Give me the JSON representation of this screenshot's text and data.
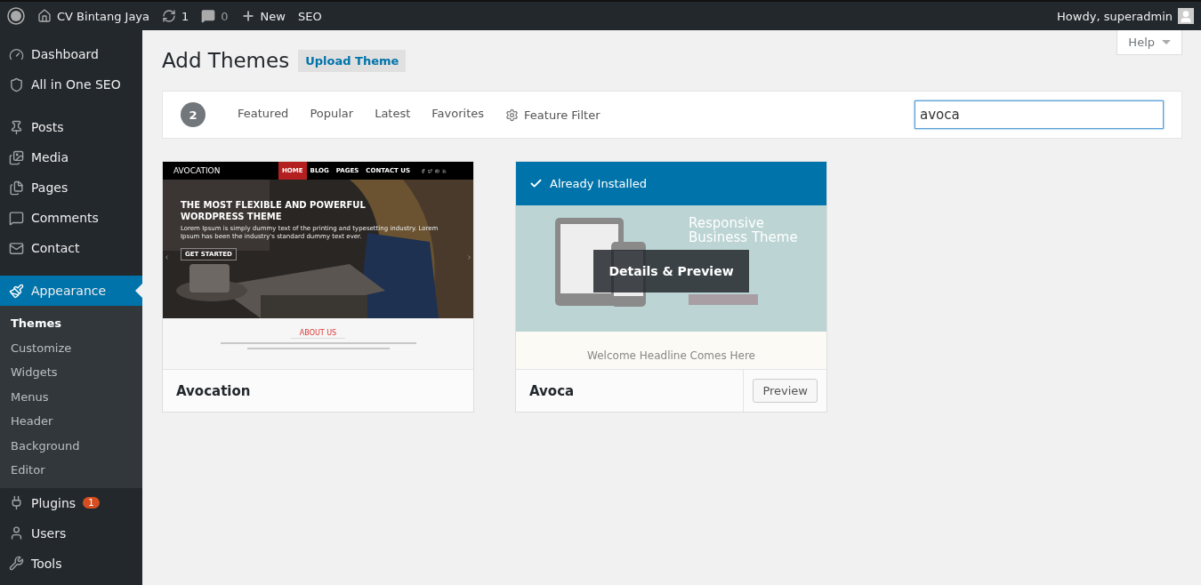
{
  "admin_bar": {
    "site_name": "CV Bintang Jaya",
    "updates": "1",
    "comments": "0",
    "new_label": "New",
    "seo_label": "SEO",
    "greeting": "Howdy, superadmin"
  },
  "sidebar": {
    "groups": [
      [
        {
          "label": "Dashboard",
          "selected": false
        },
        {
          "label": "All in One SEO",
          "selected": false
        }
      ],
      [
        {
          "label": "Posts",
          "selected": false
        },
        {
          "label": "Media",
          "selected": false
        },
        {
          "label": "Pages",
          "selected": false
        },
        {
          "label": "Comments",
          "selected": false
        },
        {
          "label": "Contact",
          "selected": false
        }
      ],
      [
        {
          "label": "Appearance",
          "selected": true,
          "children": [
            {
              "label": "Themes",
              "selected": true
            },
            {
              "label": "Customize",
              "selected": false
            },
            {
              "label": "Widgets",
              "selected": false
            },
            {
              "label": "Menus",
              "selected": false
            },
            {
              "label": "Header",
              "selected": false
            },
            {
              "label": "Background",
              "selected": false
            },
            {
              "label": "Editor",
              "selected": false
            }
          ]
        },
        {
          "label": "Plugins",
          "selected": false,
          "badge": "1"
        },
        {
          "label": "Users",
          "selected": false
        },
        {
          "label": "Tools",
          "selected": false
        }
      ]
    ]
  },
  "page": {
    "title": "Add Themes",
    "upload_button": "Upload Theme",
    "help_button": "Help"
  },
  "filter_bar": {
    "count": "2",
    "tabs": [
      {
        "label": "Featured",
        "selected": false
      },
      {
        "label": "Popular",
        "selected": false
      },
      {
        "label": "Latest",
        "selected": false
      },
      {
        "label": "Favorites",
        "selected": false
      }
    ],
    "feature_filter": "Feature Filter",
    "search_value": "avoca"
  },
  "themes": [
    {
      "name": "Avocation",
      "installed": false,
      "kind": "dark-hero",
      "preview": {
        "logo": "AVOCATION",
        "nav": [
          {
            "label": "HOME",
            "selected": true
          },
          {
            "label": "BLOG",
            "selected": false
          },
          {
            "label": "PAGES",
            "selected": false
          },
          {
            "label": "CONTACT US",
            "selected": false
          }
        ],
        "headline": "THE MOST FLEXIBLE AND POWERFUL WORDPRESS THEME",
        "text": "Lorem Ipsum is simply dummy text of the printing and typesetting industry. Lorem Ipsum has been the industry's standard dummy text ever.",
        "button": "GET STARTED",
        "section_title": "ABOUT US"
      }
    },
    {
      "name": "Avoca",
      "installed": true,
      "installed_label": "Already Installed",
      "kind": "device-mockup",
      "hover_label": "Details & Preview",
      "preview_button": "Preview",
      "preview": {
        "headline": "Responsive Business Theme",
        "section_title": "Welcome Headline Comes Here"
      }
    }
  ]
}
